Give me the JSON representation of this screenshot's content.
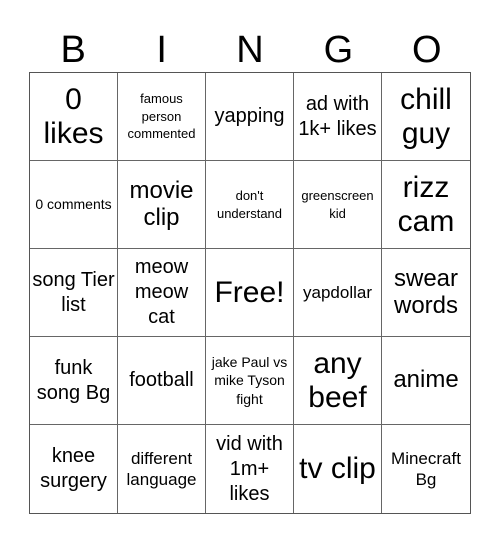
{
  "header": {
    "letters": [
      "B",
      "I",
      "N",
      "G",
      "O"
    ]
  },
  "cells": [
    {
      "text": "0 likes",
      "size": "xl"
    },
    {
      "text": "famous person commented",
      "size": "xs"
    },
    {
      "text": "yapping",
      "size": "m"
    },
    {
      "text": "ad with 1k+ likes",
      "size": "m"
    },
    {
      "text": "chill guy",
      "size": "xl"
    },
    {
      "text": "0 comments",
      "size": "s"
    },
    {
      "text": "movie clip",
      "size": "l"
    },
    {
      "text": "don't understand",
      "size": "xs"
    },
    {
      "text": "greenscreen kid",
      "size": "xs"
    },
    {
      "text": "rizz cam",
      "size": "xl"
    },
    {
      "text": "song Tier list",
      "size": "m"
    },
    {
      "text": "meow meow cat",
      "size": "m"
    },
    {
      "text": "Free!",
      "size": "xl"
    },
    {
      "text": "yapdollar",
      "size": "ms"
    },
    {
      "text": "swear words",
      "size": "l"
    },
    {
      "text": "funk song Bg",
      "size": "m"
    },
    {
      "text": "football",
      "size": "m"
    },
    {
      "text": "jake Paul vs mike Tyson fight",
      "size": "s"
    },
    {
      "text": "any beef",
      "size": "xl"
    },
    {
      "text": "anime",
      "size": "l"
    },
    {
      "text": "knee surgery",
      "size": "m"
    },
    {
      "text": "different language",
      "size": "ms"
    },
    {
      "text": "vid with 1m+ likes",
      "size": "m"
    },
    {
      "text": "tv clip",
      "size": "xl"
    },
    {
      "text": "Minecraft Bg",
      "size": "ms"
    }
  ]
}
